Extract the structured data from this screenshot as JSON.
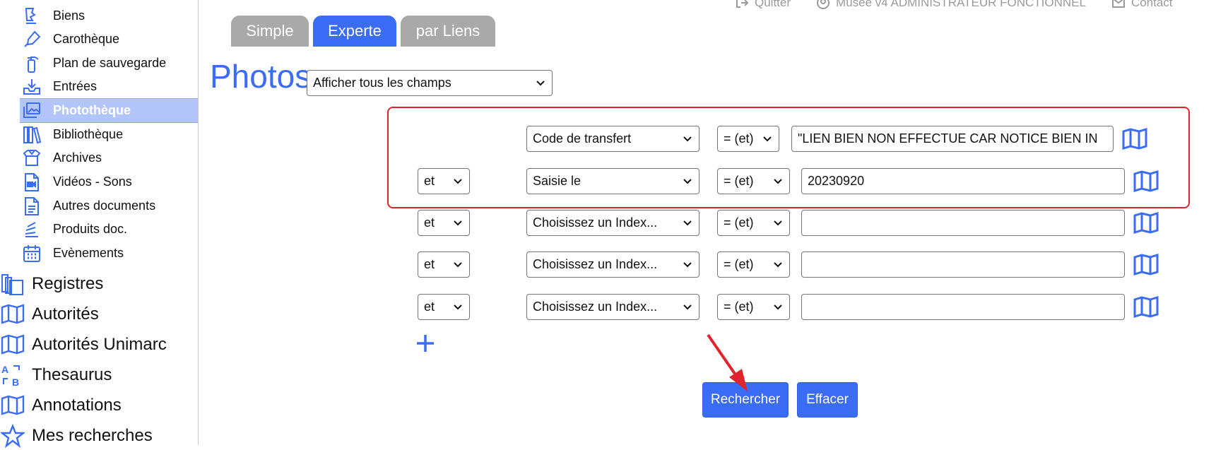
{
  "header": {
    "links": [
      {
        "label": "Quitter",
        "icon": "logout-icon"
      },
      {
        "label": "Musée v4 ADMINISTRATEUR FONCTIONNEL",
        "icon": "user-icon"
      },
      {
        "label": "Contact",
        "icon": "mail-icon"
      }
    ]
  },
  "sidebar": {
    "sub_items": [
      {
        "label": "Biens",
        "icon": "object-icon"
      },
      {
        "label": "Carothèque",
        "icon": "pen-icon"
      },
      {
        "label": "Plan de sauvegarde",
        "icon": "extinguisher-icon"
      },
      {
        "label": "Entrées",
        "icon": "inbox-icon"
      },
      {
        "label": "Photothèque",
        "icon": "photos-icon",
        "active": true
      },
      {
        "label": "Bibliothèque",
        "icon": "books-icon"
      },
      {
        "label": "Archives",
        "icon": "box-icon"
      },
      {
        "label": "Vidéos - Sons",
        "icon": "video-file-icon"
      },
      {
        "label": "Autres documents",
        "icon": "document-icon"
      },
      {
        "label": "Produits doc.",
        "icon": "layers-icon"
      },
      {
        "label": "Evènements",
        "icon": "calendar-icon"
      }
    ],
    "top_items": [
      {
        "label": "Registres",
        "icon": "registers-icon"
      },
      {
        "label": "Autorités",
        "icon": "open-book-icon"
      },
      {
        "label": "Autorités Unimarc",
        "icon": "open-book-icon"
      },
      {
        "label": "Thesaurus",
        "icon": "sort-az-icon"
      },
      {
        "label": "Annotations",
        "icon": "open-book-icon"
      },
      {
        "label": "Mes recherches",
        "icon": "star-icon"
      }
    ]
  },
  "tabs": [
    {
      "label": "Simple",
      "active": false
    },
    {
      "label": "Experte",
      "active": true
    },
    {
      "label": "par Liens",
      "active": false
    }
  ],
  "page": {
    "title": "Photos",
    "view_select": "Afficher tous les champs"
  },
  "criteria": [
    {
      "operator": "",
      "field": "Code de transfert",
      "comparator": "= (et)",
      "value": "\"LIEN BIEN NON EFFECTUE CAR NOTICE BIEN IN"
    },
    {
      "operator": "et",
      "field": "Saisie le",
      "comparator": "= (et)",
      "value": "20230920"
    },
    {
      "operator": "et",
      "field": "Choisissez un Index...",
      "comparator": "= (et)",
      "value": ""
    },
    {
      "operator": "et",
      "field": "Choisissez un Index...",
      "comparator": "= (et)",
      "value": ""
    },
    {
      "operator": "et",
      "field": "Choisissez un Index...",
      "comparator": "= (et)",
      "value": ""
    }
  ],
  "buttons": {
    "search": "Rechercher",
    "clear": "Effacer"
  },
  "colors": {
    "accent": "#3b6cf6",
    "highlight": "#e0242b",
    "tab_inactive": "#a9a9a9",
    "sidebar_active": "#b3c6fb"
  }
}
